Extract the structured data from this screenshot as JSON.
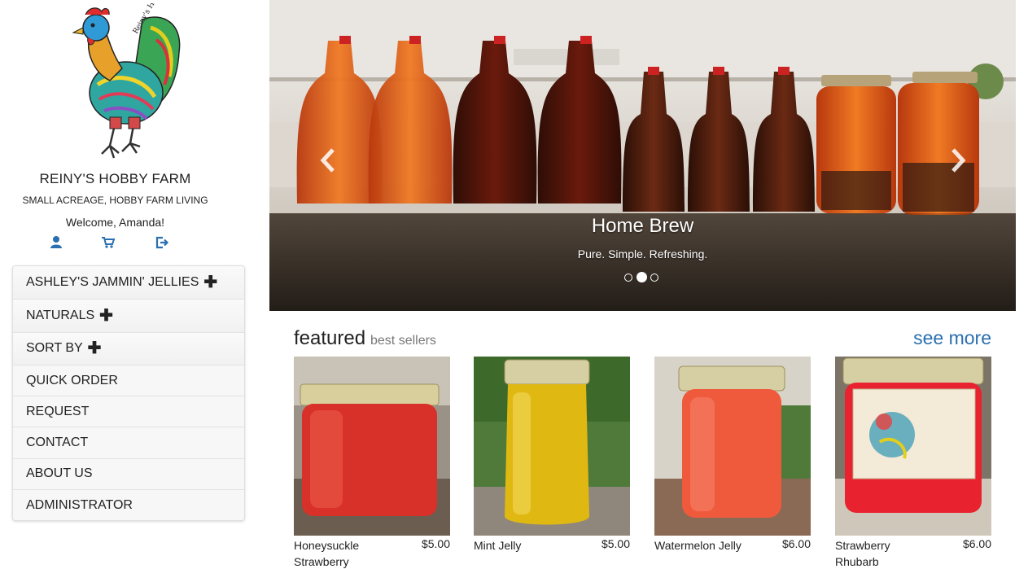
{
  "brand": {
    "title": "REINY'S HOBBY FARM",
    "subtitle": "SMALL ACREAGE, HOBBY FARM LIVING",
    "welcome": "Welcome, Amanda!",
    "logo_text": "Reiny's Hobby Farm"
  },
  "user_icons": [
    "user-icon",
    "shopping-cart-icon",
    "logout-icon"
  ],
  "menu": {
    "items": [
      {
        "label": "ASHLEY'S JAMMIN' JELLIES",
        "expandable": true
      },
      {
        "label": "NATURALS",
        "expandable": true
      },
      {
        "label": "SORT BY",
        "expandable": true
      },
      {
        "label": "QUICK ORDER",
        "expandable": false
      },
      {
        "label": "REQUEST",
        "expandable": false
      },
      {
        "label": "CONTACT",
        "expandable": false
      },
      {
        "label": "ABOUT US",
        "expandable": false
      },
      {
        "label": "ADMINISTRATOR",
        "expandable": false
      }
    ],
    "expand_glyph": "✚"
  },
  "carousel": {
    "title": "Home Brew",
    "subtitle": "Pure. Simple. Refreshing.",
    "active_slide": 1,
    "slide_count": 3
  },
  "featured": {
    "title": "featured",
    "subtitle": "best sellers",
    "see_more": "see more",
    "products": [
      {
        "name": "Honeysuckle Strawberry",
        "price": "$5.00",
        "color": "#d8312a"
      },
      {
        "name": "Mint Jelly",
        "price": "$5.00",
        "color": "#e0b812"
      },
      {
        "name": "Watermelon Jelly",
        "price": "$6.00",
        "color": "#ef5a3c"
      },
      {
        "name": "Strawberry Rhubarb",
        "price": "$6.00",
        "color": "#e8222f"
      }
    ]
  },
  "colors": {
    "link": "#2a6fb0",
    "icon": "#2a6fb0",
    "menu_bg": "#f7f7f7"
  }
}
